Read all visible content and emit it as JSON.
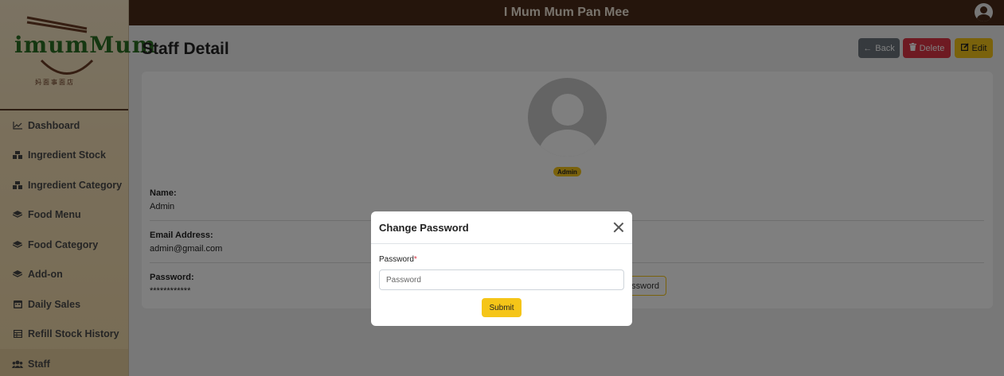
{
  "app": {
    "title": "I Mum Mum Pan Mee"
  },
  "logo": {
    "text": "imumMum",
    "subtext": "妈面事面店"
  },
  "sidebar": {
    "items": [
      {
        "label": "Dashboard",
        "icon": "chart-line-icon"
      },
      {
        "label": "Ingredient Stock",
        "icon": "boxes-icon"
      },
      {
        "label": "Ingredient Category",
        "icon": "boxes-icon"
      },
      {
        "label": "Food Menu",
        "icon": "layers-icon"
      },
      {
        "label": "Food Category",
        "icon": "layers-icon"
      },
      {
        "label": "Add-on",
        "icon": "layers-icon"
      },
      {
        "label": "Daily Sales",
        "icon": "calendar-icon"
      },
      {
        "label": "Refill Stock History",
        "icon": "table-icon"
      },
      {
        "label": "Staff",
        "icon": "users-icon",
        "active": true
      }
    ]
  },
  "page": {
    "title": "Staff Detail",
    "buttons": {
      "back": "Back",
      "delete": "Delete",
      "edit": "Edit"
    }
  },
  "staff": {
    "role": "Admin",
    "name_label": "Name:",
    "name": "Admin",
    "email_label": "Email Address:",
    "email": "admin@gmail.com",
    "password_label": "Password:",
    "password": "************",
    "change_password_partial": "ssword"
  },
  "modal": {
    "title": "Change Password",
    "field_label": "Password",
    "required_mark": "*",
    "placeholder": "Password",
    "value": "",
    "submit": "Submit"
  },
  "colors": {
    "topbar": "#4b2b18",
    "accent": "#f5c518",
    "danger": "#dc3545",
    "secondary": "#6c757d"
  }
}
